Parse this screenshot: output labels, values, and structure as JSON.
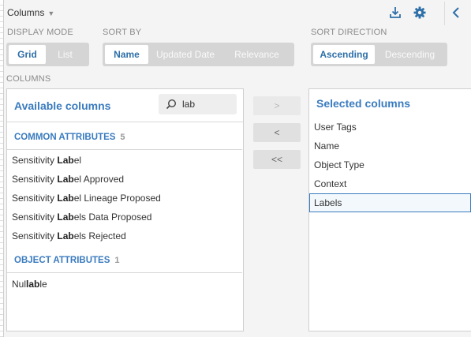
{
  "header": {
    "title": "Columns",
    "icons": [
      "download-icon",
      "gear-icon",
      "chevron-left-icon"
    ]
  },
  "display_mode": {
    "label": "DISPLAY MODE",
    "options": [
      "Grid",
      "List"
    ],
    "selected": "Grid"
  },
  "sort_by": {
    "label": "SORT BY",
    "options": [
      "Name",
      "Updated Date",
      "Relevance"
    ],
    "selected": "Name"
  },
  "sort_direction": {
    "label": "SORT DIRECTION",
    "options": [
      "Ascending",
      "Descending"
    ],
    "selected": "Ascending"
  },
  "columns_label": "COLUMNS",
  "available": {
    "title": "Available columns",
    "search_value": "lab",
    "groups": [
      {
        "name": "COMMON ATTRIBUTES",
        "count": "5",
        "items": [
          {
            "before": "Sensitivity ",
            "match": "Lab",
            "after": "el"
          },
          {
            "before": "Sensitivity ",
            "match": "Lab",
            "after": "el Approved"
          },
          {
            "before": "Sensitivity ",
            "match": "Lab",
            "after": "el Lineage Proposed"
          },
          {
            "before": "Sensitivity ",
            "match": "Lab",
            "after": "els Data Proposed"
          },
          {
            "before": "Sensitivity ",
            "match": "Lab",
            "after": "els Rejected"
          }
        ]
      },
      {
        "name": "OBJECT ATTRIBUTES",
        "count": "1",
        "items": [
          {
            "before": "Nul",
            "match": "lab",
            "after": "le"
          }
        ]
      }
    ]
  },
  "move_buttons": {
    "add": ">",
    "remove": "<",
    "remove_all": "<<"
  },
  "selected": {
    "title": "Selected columns",
    "items": [
      "User Tags",
      "Name",
      "Object Type",
      "Context",
      "Labels"
    ],
    "highlighted": "Labels"
  },
  "colors": {
    "accent": "#3a7bbf",
    "segment_bg": "#d5d5d5",
    "panel_border": "#cfcfcf"
  }
}
